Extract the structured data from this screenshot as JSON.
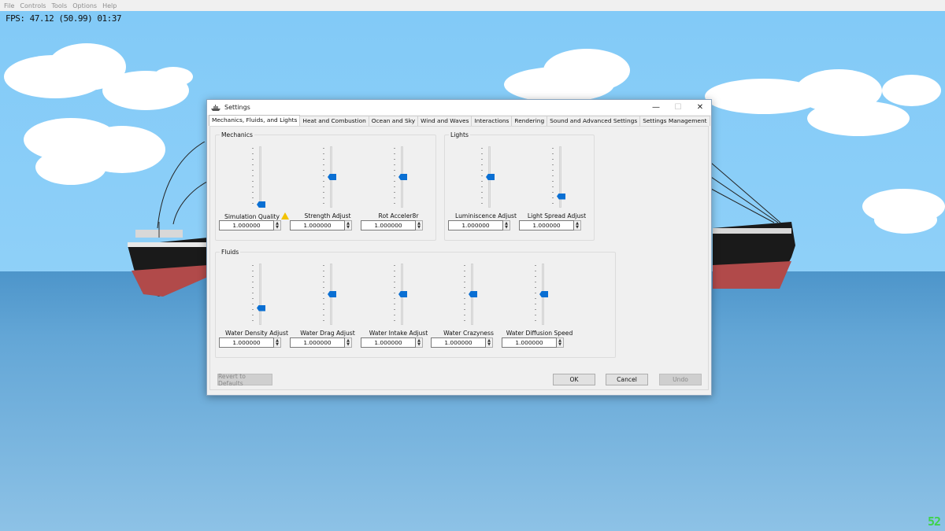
{
  "menubar": {
    "items": [
      "File",
      "Controls",
      "Tools",
      "Options",
      "Help"
    ]
  },
  "hud": {
    "fps_text": "FPS: 47.12 (50.99) 01:37"
  },
  "corner_badge": "52",
  "dialog": {
    "title": "Settings",
    "window_buttons": {
      "minimize": "—",
      "maximize": "☐",
      "close": "✕"
    },
    "tabs": [
      {
        "label": "Mechanics, Fluids, and Lights",
        "active": true
      },
      {
        "label": "Heat and Combustion"
      },
      {
        "label": "Ocean and Sky"
      },
      {
        "label": "Wind and Waves"
      },
      {
        "label": "Interactions"
      },
      {
        "label": "Rendering"
      },
      {
        "label": "Sound and Advanced Settings"
      },
      {
        "label": "Settings Management"
      }
    ],
    "groups": {
      "mechanics": {
        "label": "Mechanics",
        "sliders": [
          {
            "label": "Simulation Quality",
            "value": "1.000000",
            "level": 0.0,
            "warning_icon": "warning-icon"
          },
          {
            "label": "Strength Adjust",
            "value": "1.000000",
            "level": 0.5
          },
          {
            "label": "Rot Acceler8r",
            "value": "1.000000",
            "level": 0.5
          }
        ]
      },
      "lights": {
        "label": "Lights",
        "sliders": [
          {
            "label": "Luminiscence Adjust",
            "value": "1.000000",
            "level": 0.5
          },
          {
            "label": "Light Spread Adjust",
            "value": "1.000000",
            "level": 0.15
          }
        ]
      },
      "fluids": {
        "label": "Fluids",
        "sliders": [
          {
            "label": "Water Density Adjust",
            "value": "1.000000",
            "level": 0.25
          },
          {
            "label": "Water Drag Adjust",
            "value": "1.000000",
            "level": 0.5
          },
          {
            "label": "Water Intake Adjust",
            "value": "1.000000",
            "level": 0.5
          },
          {
            "label": "Water Crazyness",
            "value": "1.000000",
            "level": 0.5
          },
          {
            "label": "Water Diffusion Speed",
            "value": "1.000000",
            "level": 0.5
          }
        ]
      }
    },
    "buttons": {
      "revert": "Revert to Defaults",
      "ok": "OK",
      "cancel": "Cancel",
      "undo": "Undo"
    },
    "colors": {
      "accent": "#0a6fd3",
      "warning": "#f2c200"
    }
  }
}
